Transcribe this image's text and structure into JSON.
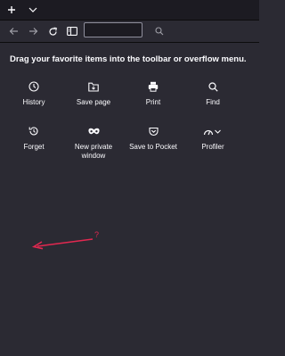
{
  "tabbar": {
    "new_tab_icon": "plus-icon",
    "list_all_tabs_icon": "chevron-down-icon"
  },
  "toolbar": {
    "back_icon": "back-arrow-icon",
    "forward_icon": "forward-arrow-icon",
    "reload_icon": "reload-icon",
    "sidebar_icon": "sidebar-icon",
    "url_value": "",
    "search_icon": "search-icon"
  },
  "customize": {
    "heading": "Drag your favorite items into the toolbar or overflow menu.",
    "items": [
      {
        "label": "History",
        "icon": "clock-icon"
      },
      {
        "label": "Save page",
        "icon": "folder-save-icon"
      },
      {
        "label": "Print",
        "icon": "printer-icon"
      },
      {
        "label": "Find",
        "icon": "magnifier-icon"
      },
      {
        "label": "Forget",
        "icon": "forget-history-icon"
      },
      {
        "label": "New private\nwindow",
        "icon": "private-mask-icon"
      },
      {
        "label": "Save to Pocket",
        "icon": "pocket-icon"
      },
      {
        "label": "Profiler",
        "icon": "profiler-gauge-icon"
      }
    ]
  },
  "annotation": {
    "text": "?",
    "color": "#e22850"
  },
  "colors": {
    "background": "#2b2a33",
    "tabbar": "#1c1b22",
    "text": "#fbfbfe",
    "annotation": "#e22850"
  }
}
